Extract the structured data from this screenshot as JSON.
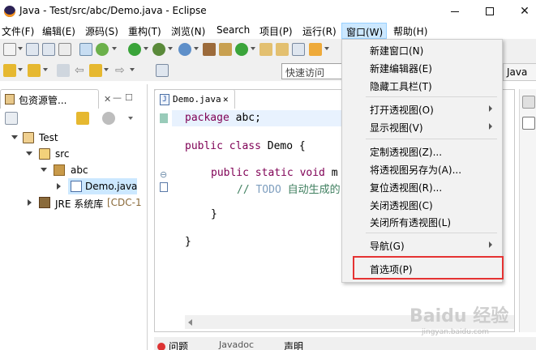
{
  "window": {
    "title": "Java  -  Test/src/abc/Demo.java  -  Eclipse",
    "minimize": "—",
    "maximize": "☐",
    "close": "✕"
  },
  "menubar": {
    "items": [
      "文件(F)",
      "编辑(E)",
      "源码(S)",
      "重构(T)",
      "浏览(N)",
      "Search",
      "项目(P)",
      "运行(R)",
      "窗口(W)",
      "帮助(H)"
    ],
    "active": "窗口(W)"
  },
  "toolbar": {
    "quick_access": "快速访问",
    "perspective_label": "Java"
  },
  "package_explorer": {
    "tab_label": "包资源管...",
    "tree": [
      {
        "label": "Test",
        "level": 0,
        "expanded": true,
        "icon": "project-icon"
      },
      {
        "label": "src",
        "level": 1,
        "expanded": true,
        "icon": "source-folder-icon"
      },
      {
        "label": "abc",
        "level": 2,
        "expanded": true,
        "icon": "package-icon"
      },
      {
        "label": "Demo.java",
        "level": 3,
        "expanded": false,
        "icon": "java-file-icon",
        "selected": true
      },
      {
        "label": "JRE 系统库",
        "suffix": "[CDC-1",
        "level": 1,
        "expanded": false,
        "icon": "jre-library-icon"
      }
    ]
  },
  "editor": {
    "tab_label": "Demo.java",
    "tab_close": "✕",
    "code": {
      "line1_kw": "package",
      "line1_rest": " abc;",
      "line2_kw": "public class",
      "line2_rest": " Demo {",
      "line3_kw": "public static void",
      "line3_rest": " m",
      "line4_comment": "// ",
      "line4_todo": "TODO",
      "line4_rest": " 自动生成的",
      "line5": "}",
      "line6": "}"
    }
  },
  "window_menu": {
    "items": [
      {
        "label": "新建窗口(N)",
        "submenu": false
      },
      {
        "label": "新建编辑器(E)",
        "submenu": false
      },
      {
        "label": "隐藏工具栏(T)",
        "submenu": false
      },
      {
        "label": "打开透视图(O)",
        "submenu": true
      },
      {
        "label": "显示视图(V)",
        "submenu": true
      },
      {
        "label": "定制透视图(Z)...",
        "submenu": false
      },
      {
        "label": "将透视图另存为(A)...",
        "submenu": false
      },
      {
        "label": "复位透视图(R)...",
        "submenu": false
      },
      {
        "label": "关闭透视图(C)",
        "submenu": false
      },
      {
        "label": "关闭所有透视图(L)",
        "submenu": false
      },
      {
        "label": "导航(G)",
        "submenu": true
      },
      {
        "label": "首选项(P)",
        "submenu": false,
        "highlighted": true
      }
    ],
    "highlight_color": "#e53333"
  },
  "bottom_panel": {
    "tabs": [
      "问题",
      "Javadoc",
      "声明"
    ]
  },
  "watermark": {
    "text": "Baidu 经验",
    "sub": "jingyan.baidu.com"
  }
}
